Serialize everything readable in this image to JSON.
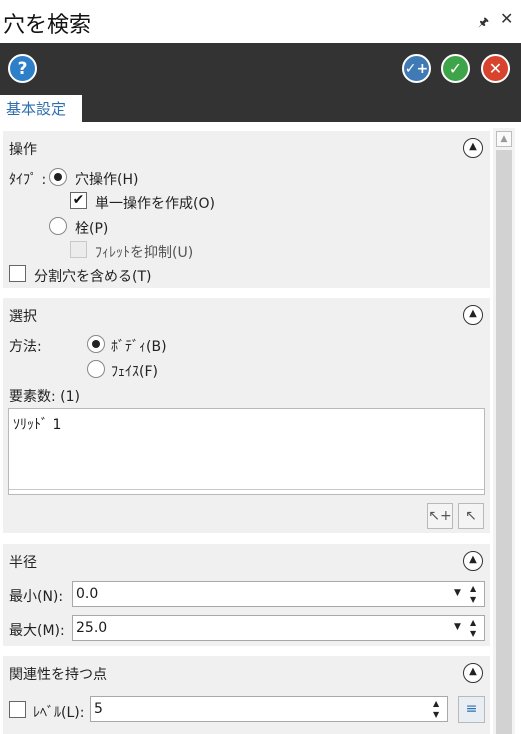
{
  "window": {
    "title": "穴を検索",
    "pin_icon": "pin-icon",
    "close_icon": "close-icon"
  },
  "toolbar": {
    "help_icon": "help-icon",
    "add_icon": "add-icon",
    "ok_icon": "ok-icon",
    "cancel_icon": "cancel-icon"
  },
  "tabs": [
    {
      "label": "基本設定",
      "active": true
    }
  ],
  "operation": {
    "title": "操作",
    "type_label": "ﾀｲﾌﾟ :",
    "hole_op_label": "穴操作(H)",
    "hole_op_selected": true,
    "single_op_label": "単一操作を作成(O)",
    "single_op_checked": true,
    "plug_label": "栓(P)",
    "plug_selected": false,
    "suppress_fillet_label": "ﾌｨﾚｯﾄを抑制(U)",
    "suppress_fillet_checked": false,
    "include_split_label": "分割穴を含める(T)",
    "include_split_checked": false
  },
  "selection": {
    "title": "選択",
    "method_label": "方法:",
    "body_label": "ﾎﾞﾃﾞｨ(B)",
    "body_selected": true,
    "face_label": "ﾌｪｲｽ(F)",
    "face_selected": false,
    "count_label": "要素数: (1)",
    "items": [
      "ｿﾘｯﾄﾞ 1"
    ]
  },
  "radius": {
    "title": "半径",
    "min_label": "最小(N):",
    "min_value": "0.0",
    "max_label": "最大(M):",
    "max_value": "25.0"
  },
  "relevance": {
    "title": "関連性を持つ点",
    "level_label": "ﾚﾍﾞﾙ(L):",
    "level_checked": false,
    "level_value": "5"
  },
  "colors": {
    "toolbar_bg": "#333333",
    "tab_text": "#2f6fae",
    "help": "#2d7fc8",
    "ok": "#3ea44a",
    "cancel": "#d8432e",
    "section_bg": "#f0f0f0"
  }
}
